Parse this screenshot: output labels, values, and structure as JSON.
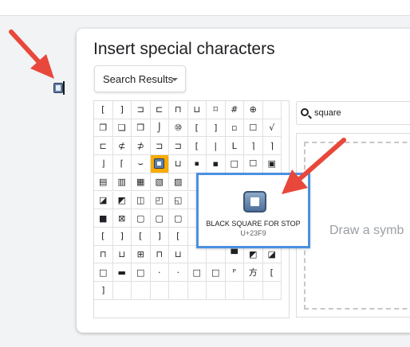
{
  "document": {
    "inserted_character": "⏹"
  },
  "dialog": {
    "title": "Insert special characters",
    "category_select": "Search Results",
    "search": {
      "value": "square",
      "placeholder": ""
    },
    "draw_hint": "Draw a symb",
    "selected_index": 33,
    "characters": [
      "[",
      "]",
      "⊐",
      "⊏",
      "⊓",
      "⊔",
      "⌑",
      "#",
      "⊕",
      "",
      "❐",
      "❑",
      "❒",
      "⌡",
      "⑩",
      "[",
      "]",
      "▫",
      "☐",
      "√",
      "⊏",
      "⊄",
      "⊅",
      "⊐",
      "⊐",
      "[",
      "|",
      "L",
      "⌉",
      "⌉",
      "⌋",
      "⌈",
      "⌣",
      "⋈",
      "⊔",
      "⏹",
      "▪",
      "□",
      "☐",
      "▣",
      "▤",
      "▥",
      "▦",
      "▧",
      "▨",
      "",
      "",
      "",
      "",
      "",
      "◪",
      "◩",
      "◫",
      "◰",
      "◱",
      "",
      "",
      "",
      "",
      "",
      "■",
      "⊠",
      "▢",
      "▢",
      "▢",
      "",
      "",
      "",
      "",
      "",
      "[",
      "]",
      "[",
      "]",
      "[",
      "",
      "",
      "",
      "",
      "",
      "⊓",
      "⊔",
      "⊞",
      "⊓",
      "⊔",
      "",
      "",
      "▀",
      "◩",
      "◪",
      "□",
      "▬",
      "□",
      "·",
      "·",
      "□",
      "□",
      "ᴾ",
      "方",
      "[",
      "]",
      "",
      "",
      "",
      "",
      "",
      "",
      "",
      "",
      ""
    ],
    "tooltip": {
      "name": "BLACK SQUARE FOR STOP",
      "code": "U+23F9"
    }
  },
  "colors": {
    "selected_cell": "#f9ab00",
    "tooltip_border": "#4a90e2",
    "arrow": "#e8483b"
  }
}
